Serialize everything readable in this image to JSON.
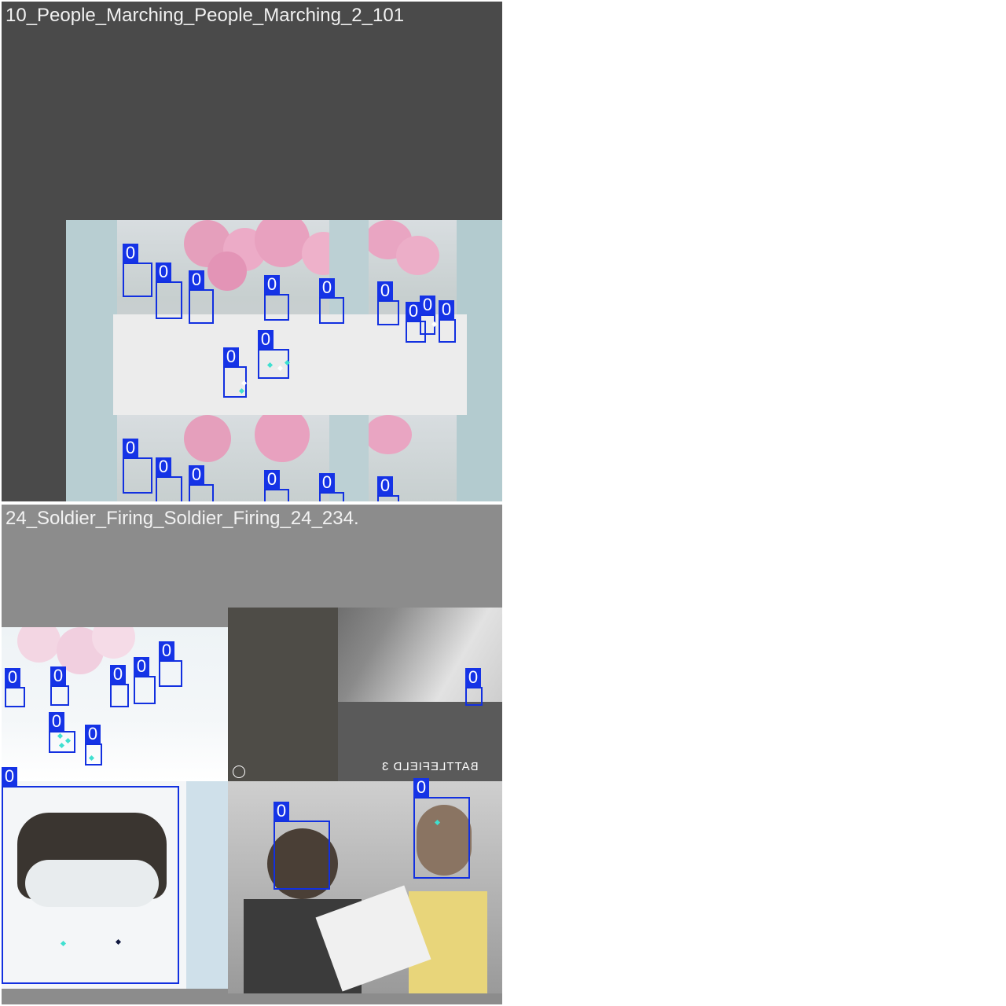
{
  "tiles": [
    {
      "title": "10_People_Marching_People_Marching_2_101"
    },
    {
      "title": "24_Soldier_Firing_Soldier_Firing_24_234."
    }
  ],
  "detection_label": "0",
  "watermark": "BATTLEFIELD 3",
  "colors": {
    "tile1_bg": "#4a4a4a",
    "tile2_bg": "#8c8c8c",
    "box": "#1230e0",
    "label_bg": "#1533e6",
    "keypoint_cyan": "#3fe0d0",
    "keypoint_white": "#ffffff"
  }
}
